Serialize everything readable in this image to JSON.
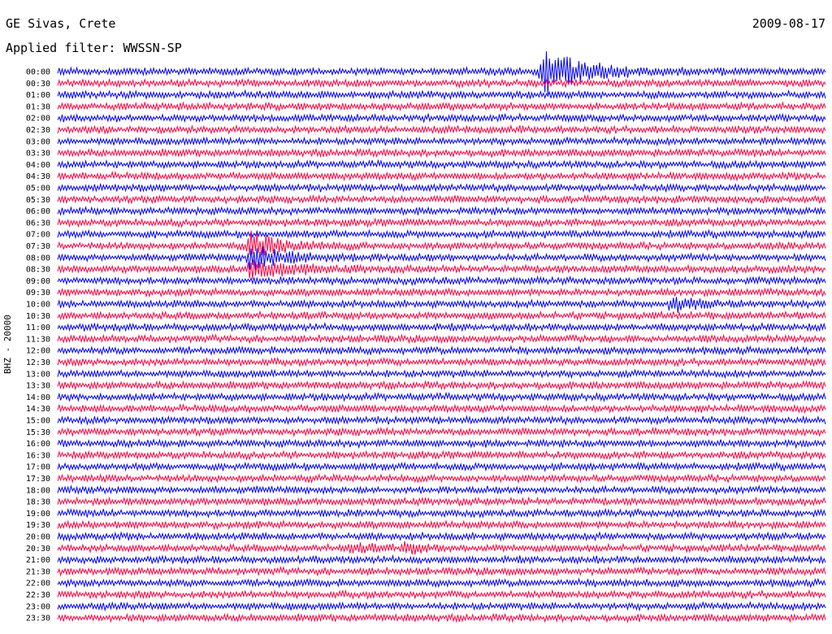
{
  "header": {
    "station": "GE Sivas, Crete",
    "date": "2009-08-17",
    "filter": "Applied filter: WWSSN-SP"
  },
  "chart_data": {
    "type": "line",
    "title": "GE Sivas, Crete",
    "ylabel": "BHZ - 20000",
    "row_labels": [
      "00:00",
      "00:30",
      "01:00",
      "01:30",
      "02:00",
      "02:30",
      "03:00",
      "03:30",
      "04:00",
      "04:30",
      "05:00",
      "05:30",
      "06:00",
      "06:30",
      "07:00",
      "07:30",
      "08:00",
      "08:30",
      "09:00",
      "09:30",
      "10:00",
      "10:30",
      "11:00",
      "11:30",
      "12:00",
      "12:30",
      "13:00",
      "13:30",
      "14:00",
      "14:30",
      "15:00",
      "15:30",
      "16:00",
      "16:30",
      "17:00",
      "17:30",
      "18:00",
      "18:30",
      "19:00",
      "19:30",
      "20:00",
      "20:30",
      "21:00",
      "21:30",
      "22:00",
      "22:30",
      "23:00",
      "23:30"
    ],
    "row_colors": [
      "#0000ff",
      "#ff0040"
    ],
    "events": [
      {
        "row": "00:00",
        "position": 0.63,
        "amplitude": 5.5,
        "decay": 0.055
      },
      {
        "row": "07:30",
        "position": 0.25,
        "amplitude": 3.0,
        "decay": 0.04
      },
      {
        "row": "08:00",
        "position": 0.25,
        "amplitude": 2.8,
        "decay": 0.05
      },
      {
        "row": "08:30",
        "position": 0.25,
        "amplitude": 2.2,
        "decay": 0.05
      },
      {
        "row": "10:00",
        "position": 0.8,
        "amplitude": 1.6,
        "decay": 0.03
      },
      {
        "row": "20:30",
        "position": 0.38,
        "amplitude": 1.3,
        "decay": 0.02
      },
      {
        "row": "20:30",
        "position": 0.45,
        "amplitude": 1.3,
        "decay": 0.02
      }
    ]
  }
}
